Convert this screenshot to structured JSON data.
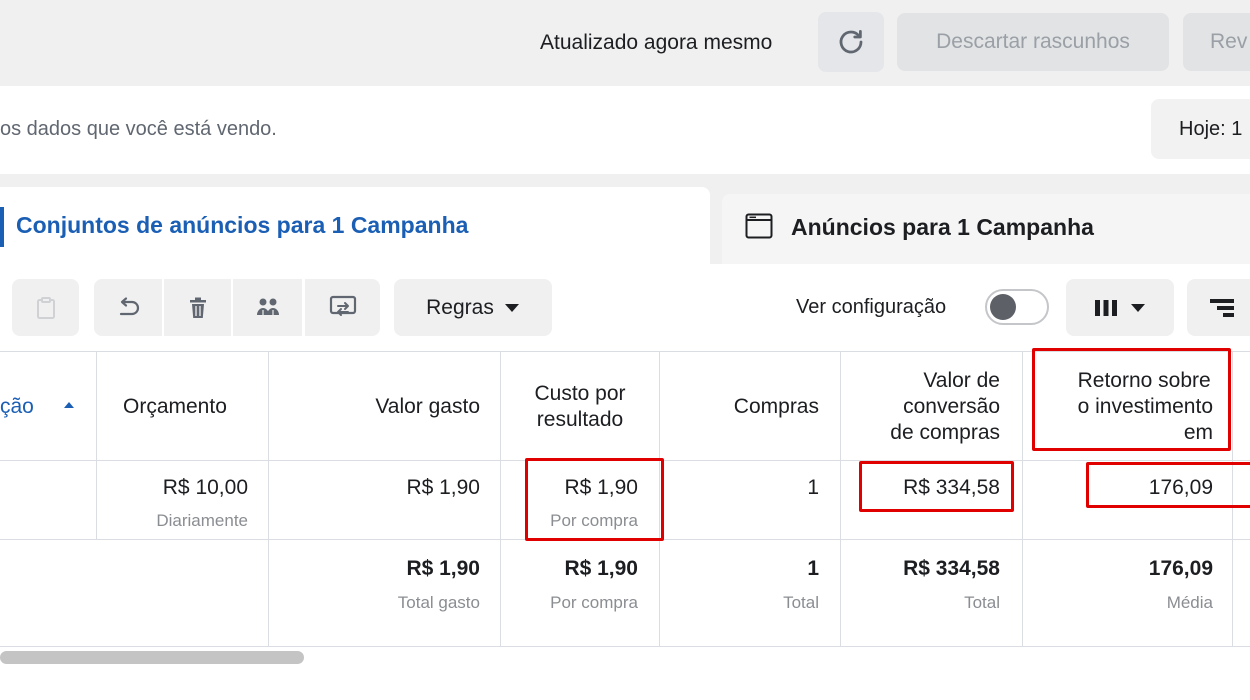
{
  "header": {
    "updated_text": "Atualizado agora mesmo",
    "discard_label": "Descartar rascunhos",
    "review_label": "Rev"
  },
  "info": {
    "text": "os dados que você está vendo.",
    "date_label": "Hoje: 1"
  },
  "tabs": [
    {
      "label": "Conjuntos de anúncios para 1 Campanha",
      "active": true
    },
    {
      "label": "Anúncios para 1 Campanha",
      "active": false
    }
  ],
  "toolbar": {
    "rules_label": "Regras",
    "view_config_label": "Ver configuração"
  },
  "table": {
    "headers": {
      "sort_col": "ção",
      "budget": "Orçamento",
      "spent": "Valor gasto",
      "cost_per_result": [
        "Custo por",
        "resultado"
      ],
      "purchases": "Compras",
      "conversion_value": [
        "Valor de",
        "conversão",
        "de compras"
      ],
      "roas": [
        "Retorno sobre",
        "o investimento",
        "em"
      ]
    },
    "row": {
      "budget": "R$ 10,00",
      "budget_sub": "Diariamente",
      "spent": "R$ 1,90",
      "cost_per_result": "R$ 1,90",
      "cost_sub": "Por compra",
      "purchases": "1",
      "conversion_value": "R$ 334,58",
      "roas": "176,09"
    },
    "totals": {
      "spent": "R$ 1,90",
      "spent_sub": "Total gasto",
      "cost_per_result": "R$ 1,90",
      "cost_sub": "Por compra",
      "purchases": "1",
      "purchases_sub": "Total",
      "conversion_value": "R$ 334,58",
      "conversion_sub": "Total",
      "roas": "176,09",
      "roas_sub": "Média"
    }
  },
  "colors": {
    "accent": "#1b5fb5",
    "highlight": "#e00000",
    "muted_text": "#8a8d91"
  }
}
